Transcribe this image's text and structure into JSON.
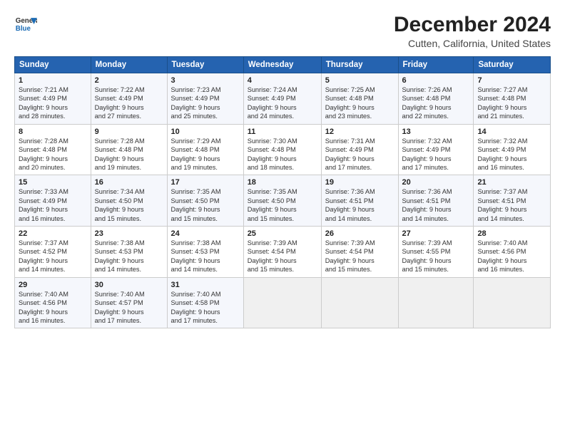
{
  "header": {
    "title": "December 2024",
    "subtitle": "Cutten, California, United States"
  },
  "calendar": {
    "headers": [
      "Sunday",
      "Monday",
      "Tuesday",
      "Wednesday",
      "Thursday",
      "Friday",
      "Saturday"
    ],
    "weeks": [
      [
        {
          "day": "1",
          "info": "Sunrise: 7:21 AM\nSunset: 4:49 PM\nDaylight: 9 hours\nand 28 minutes."
        },
        {
          "day": "2",
          "info": "Sunrise: 7:22 AM\nSunset: 4:49 PM\nDaylight: 9 hours\nand 27 minutes."
        },
        {
          "day": "3",
          "info": "Sunrise: 7:23 AM\nSunset: 4:49 PM\nDaylight: 9 hours\nand 25 minutes."
        },
        {
          "day": "4",
          "info": "Sunrise: 7:24 AM\nSunset: 4:49 PM\nDaylight: 9 hours\nand 24 minutes."
        },
        {
          "day": "5",
          "info": "Sunrise: 7:25 AM\nSunset: 4:48 PM\nDaylight: 9 hours\nand 23 minutes."
        },
        {
          "day": "6",
          "info": "Sunrise: 7:26 AM\nSunset: 4:48 PM\nDaylight: 9 hours\nand 22 minutes."
        },
        {
          "day": "7",
          "info": "Sunrise: 7:27 AM\nSunset: 4:48 PM\nDaylight: 9 hours\nand 21 minutes."
        }
      ],
      [
        {
          "day": "8",
          "info": "Sunrise: 7:28 AM\nSunset: 4:48 PM\nDaylight: 9 hours\nand 20 minutes."
        },
        {
          "day": "9",
          "info": "Sunrise: 7:28 AM\nSunset: 4:48 PM\nDaylight: 9 hours\nand 19 minutes."
        },
        {
          "day": "10",
          "info": "Sunrise: 7:29 AM\nSunset: 4:48 PM\nDaylight: 9 hours\nand 19 minutes."
        },
        {
          "day": "11",
          "info": "Sunrise: 7:30 AM\nSunset: 4:48 PM\nDaylight: 9 hours\nand 18 minutes."
        },
        {
          "day": "12",
          "info": "Sunrise: 7:31 AM\nSunset: 4:49 PM\nDaylight: 9 hours\nand 17 minutes."
        },
        {
          "day": "13",
          "info": "Sunrise: 7:32 AM\nSunset: 4:49 PM\nDaylight: 9 hours\nand 17 minutes."
        },
        {
          "day": "14",
          "info": "Sunrise: 7:32 AM\nSunset: 4:49 PM\nDaylight: 9 hours\nand 16 minutes."
        }
      ],
      [
        {
          "day": "15",
          "info": "Sunrise: 7:33 AM\nSunset: 4:49 PM\nDaylight: 9 hours\nand 16 minutes."
        },
        {
          "day": "16",
          "info": "Sunrise: 7:34 AM\nSunset: 4:50 PM\nDaylight: 9 hours\nand 15 minutes."
        },
        {
          "day": "17",
          "info": "Sunrise: 7:35 AM\nSunset: 4:50 PM\nDaylight: 9 hours\nand 15 minutes."
        },
        {
          "day": "18",
          "info": "Sunrise: 7:35 AM\nSunset: 4:50 PM\nDaylight: 9 hours\nand 15 minutes."
        },
        {
          "day": "19",
          "info": "Sunrise: 7:36 AM\nSunset: 4:51 PM\nDaylight: 9 hours\nand 14 minutes."
        },
        {
          "day": "20",
          "info": "Sunrise: 7:36 AM\nSunset: 4:51 PM\nDaylight: 9 hours\nand 14 minutes."
        },
        {
          "day": "21",
          "info": "Sunrise: 7:37 AM\nSunset: 4:51 PM\nDaylight: 9 hours\nand 14 minutes."
        }
      ],
      [
        {
          "day": "22",
          "info": "Sunrise: 7:37 AM\nSunset: 4:52 PM\nDaylight: 9 hours\nand 14 minutes."
        },
        {
          "day": "23",
          "info": "Sunrise: 7:38 AM\nSunset: 4:53 PM\nDaylight: 9 hours\nand 14 minutes."
        },
        {
          "day": "24",
          "info": "Sunrise: 7:38 AM\nSunset: 4:53 PM\nDaylight: 9 hours\nand 14 minutes."
        },
        {
          "day": "25",
          "info": "Sunrise: 7:39 AM\nSunset: 4:54 PM\nDaylight: 9 hours\nand 15 minutes."
        },
        {
          "day": "26",
          "info": "Sunrise: 7:39 AM\nSunset: 4:54 PM\nDaylight: 9 hours\nand 15 minutes."
        },
        {
          "day": "27",
          "info": "Sunrise: 7:39 AM\nSunset: 4:55 PM\nDaylight: 9 hours\nand 15 minutes."
        },
        {
          "day": "28",
          "info": "Sunrise: 7:40 AM\nSunset: 4:56 PM\nDaylight: 9 hours\nand 16 minutes."
        }
      ],
      [
        {
          "day": "29",
          "info": "Sunrise: 7:40 AM\nSunset: 4:56 PM\nDaylight: 9 hours\nand 16 minutes."
        },
        {
          "day": "30",
          "info": "Sunrise: 7:40 AM\nSunset: 4:57 PM\nDaylight: 9 hours\nand 17 minutes."
        },
        {
          "day": "31",
          "info": "Sunrise: 7:40 AM\nSunset: 4:58 PM\nDaylight: 9 hours\nand 17 minutes."
        },
        {
          "day": "",
          "info": ""
        },
        {
          "day": "",
          "info": ""
        },
        {
          "day": "",
          "info": ""
        },
        {
          "day": "",
          "info": ""
        }
      ]
    ]
  }
}
